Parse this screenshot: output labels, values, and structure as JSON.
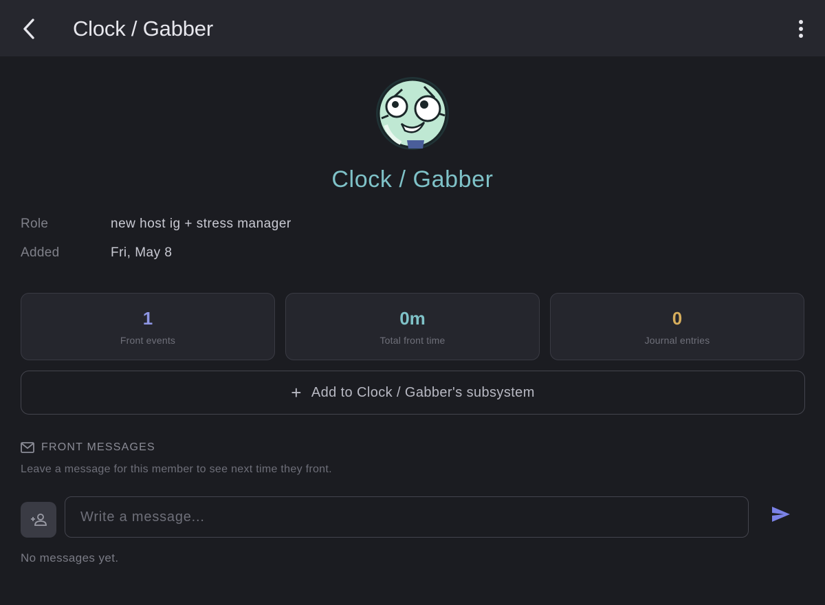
{
  "header": {
    "title": "Clock / Gabber",
    "back_icon": "chevron-left-icon",
    "menu_icon": "more-vertical-icon"
  },
  "member": {
    "name": "Clock / Gabber",
    "name_color": "#7fc2c8",
    "details": [
      {
        "label": "Role",
        "value": "new host ig + stress manager"
      },
      {
        "label": "Added",
        "value": "Fri, May 8"
      }
    ]
  },
  "stats": [
    {
      "value": "1",
      "label": "Front events",
      "color": "#8d95e3"
    },
    {
      "value": "0m",
      "label": "Total front time",
      "color": "#7fc2c8"
    },
    {
      "value": "0",
      "label": "Journal entries",
      "color": "#d6ad5c"
    }
  ],
  "subsystem": {
    "plus": "+",
    "label": "Add to Clock / Gabber's subsystem"
  },
  "front_messages": {
    "title": "FRONT MESSAGES",
    "description": "Leave a message for this member to see next time they front.",
    "input_placeholder": "Write a message...",
    "empty_text": "No messages yet.",
    "send_color": "#7b82e6"
  }
}
